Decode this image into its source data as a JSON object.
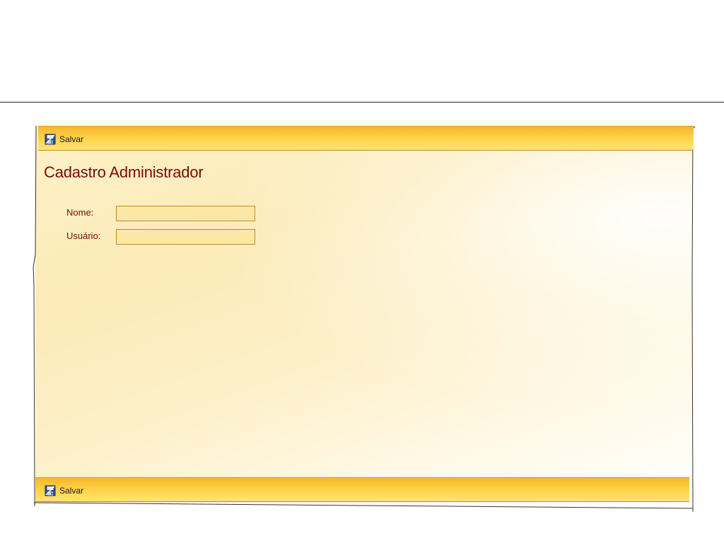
{
  "form": {
    "title": "Cadastro Administrador",
    "fields": [
      {
        "label": "Nome:",
        "value": "",
        "placeholder": ""
      },
      {
        "label": "Usuário:",
        "value": "",
        "placeholder": ""
      }
    ]
  },
  "toolbar_top": {
    "save_label": "Salvar",
    "save_icon": "save-disk-icon"
  },
  "toolbar_bottom": {
    "save_label": "Salvar",
    "save_icon": "save-disk-icon"
  },
  "colors": {
    "title": "#7a0a0a",
    "toolbar": "#fbcb3f",
    "panel": "#fdf1c8",
    "input_bg": "#fbe7a6",
    "input_border": "#c8891e"
  }
}
